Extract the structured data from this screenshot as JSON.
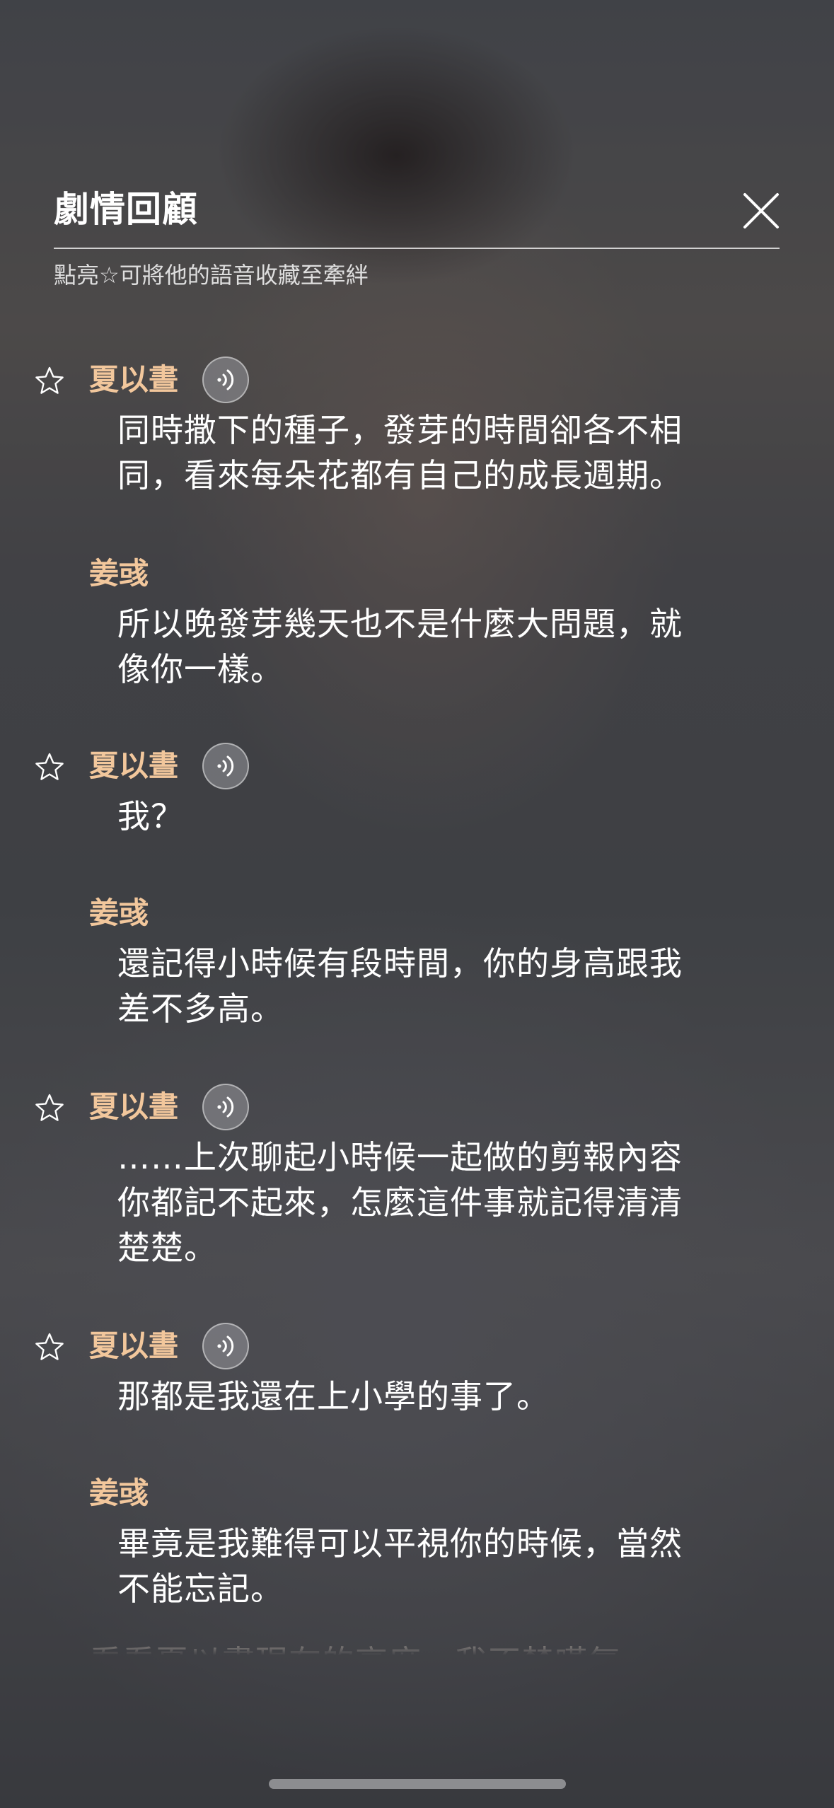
{
  "header": {
    "title": "劇情回顧",
    "hint": "點亮☆可將他的語音收藏至牽絆"
  },
  "entries": [
    {
      "speaker": "夏以晝",
      "has_star": true,
      "has_voice": true,
      "line1": "同時撒下的種子，發芽的時間卻各不相",
      "line2": "同，看來每朵花都有自己的成長週期。",
      "line3": ""
    },
    {
      "speaker": "姜彧",
      "has_star": false,
      "has_voice": false,
      "line1": "所以晚發芽幾天也不是什麼大問題，就",
      "line2": "像你一樣。",
      "line3": ""
    },
    {
      "speaker": "夏以晝",
      "has_star": true,
      "has_voice": true,
      "line1": "我？",
      "line2": "",
      "line3": ""
    },
    {
      "speaker": "姜彧",
      "has_star": false,
      "has_voice": false,
      "line1": "還記得小時候有段時間，你的身高跟我",
      "line2": "差不多高。",
      "line3": ""
    },
    {
      "speaker": "夏以晝",
      "has_star": true,
      "has_voice": true,
      "line1": "……上次聊起小時候一起做的剪報內容",
      "line2": "你都記不起來，怎麼這件事就記得清清",
      "line3": "楚楚。"
    },
    {
      "speaker": "夏以晝",
      "has_star": true,
      "has_voice": true,
      "line1": "那都是我還在上小學的事了。",
      "line2": "",
      "line3": ""
    },
    {
      "speaker": "姜彧",
      "has_star": false,
      "has_voice": false,
      "line1": "畢竟是我難得可以平視你的時候，當然",
      "line2": "不能忘記。",
      "line3": ""
    }
  ],
  "partial_line": "看看夏以晝現在的高度，我不禁嘆氣",
  "icons": {
    "close": "close-icon",
    "star": "star-outline-icon",
    "voice": "sound-wave-icon"
  },
  "colors": {
    "speaker": "#f2c79c",
    "text": "#ffffff"
  }
}
